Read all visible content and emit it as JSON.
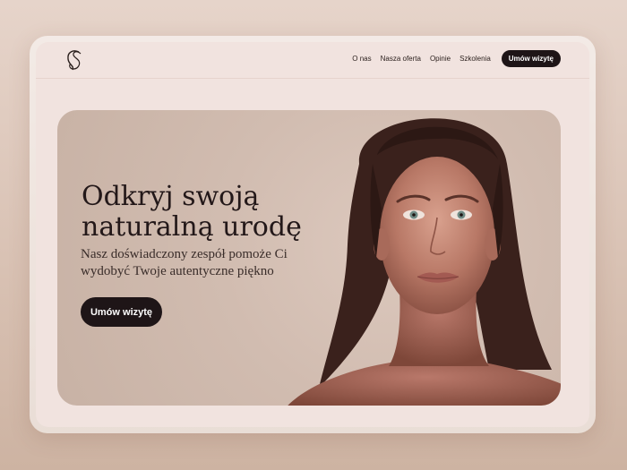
{
  "header": {
    "logo_text": "S",
    "nav": [
      "O nas",
      "Nasza oferta",
      "Opinie",
      "Szkolenia"
    ],
    "cta_label": "Umów wizytę"
  },
  "hero": {
    "headline_line1": "Odkryj swoją",
    "headline_line2": "naturalną urodę",
    "subtitle": "Nasz doświadczony zespół pomoże Ci wydobyć Twoje autentyczne piękno",
    "button_label": "Umów wizytę",
    "image": "woman-portrait"
  },
  "colors": {
    "page_bg": "#e6d4ca",
    "screen_bg": "#f1e3df",
    "hero_bg": "#d1bcb0",
    "accent_dark": "#1e1517"
  }
}
